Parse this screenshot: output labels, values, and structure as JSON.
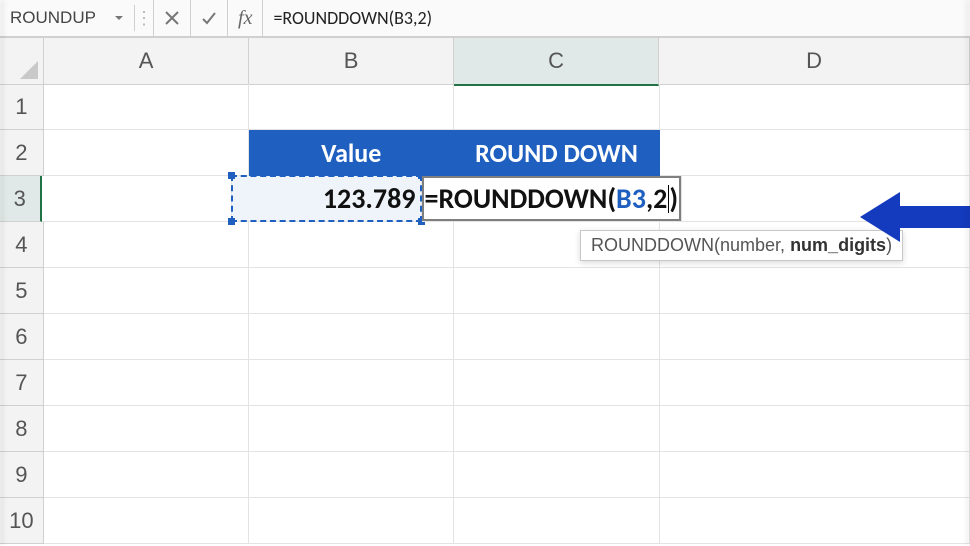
{
  "namebox": {
    "value": "ROUNDUP"
  },
  "formula_bar": {
    "text": "=ROUNDDOWN(B3,2)"
  },
  "columns": [
    "A",
    "B",
    "C",
    "D"
  ],
  "rows": [
    "1",
    "2",
    "3",
    "4",
    "5",
    "6",
    "7",
    "8",
    "9",
    "10"
  ],
  "sheet": {
    "B2": "Value",
    "C2": "ROUND DOWN",
    "B3": "123.789",
    "C3": {
      "eq": "=",
      "fn": "ROUNDDOWN",
      "open": "(",
      "ref": "B3",
      "comma": ",",
      "num": "2",
      "close": ")"
    }
  },
  "tooltip": {
    "fn": "ROUNDDOWN",
    "open": "(",
    "arg1": "number",
    "comma": ", ",
    "arg2": "num_digits",
    "close": ")"
  },
  "active": {
    "col": "C",
    "row": "3"
  }
}
